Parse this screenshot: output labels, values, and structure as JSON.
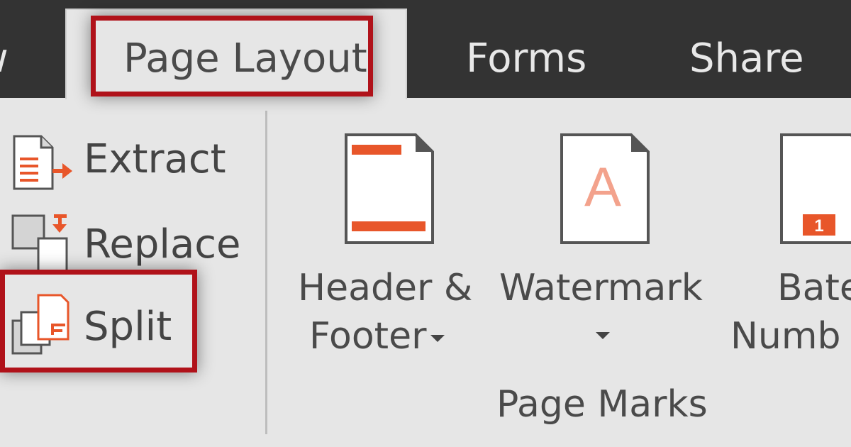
{
  "tabs": {
    "prev_partial": "w",
    "active": "Page Layout",
    "forms": "Forms",
    "share": "Share"
  },
  "pages_group": {
    "extract": "Extract",
    "replace": "Replace",
    "split": "Split"
  },
  "page_marks": {
    "header_footer_line1": "Header &",
    "header_footer_line2": "Footer",
    "watermark": "Watermark",
    "watermark_glyph": "A",
    "bates_line1": "Bate",
    "bates_line2": "Numb",
    "bates_badge": "1",
    "group_label": "Page Marks"
  },
  "colors": {
    "accent": "#e8562a",
    "highlight": "#b0121a",
    "tabbar": "#333333",
    "ribbon": "#e6e6e6"
  },
  "icons": {
    "extract": "extract-pages-icon",
    "replace": "replace-pages-icon",
    "split": "split-document-icon",
    "header_footer": "header-footer-icon",
    "watermark": "watermark-icon",
    "bates": "bates-numbering-icon"
  }
}
